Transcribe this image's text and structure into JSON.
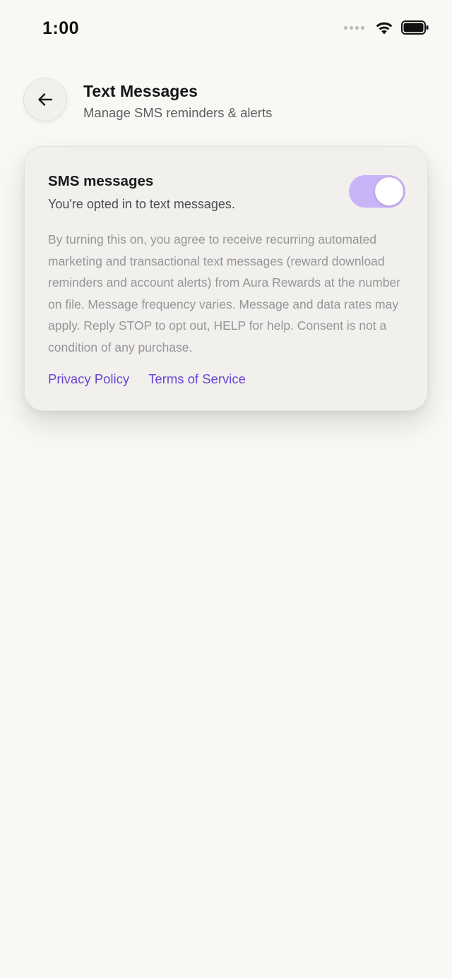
{
  "status_bar": {
    "time": "1:00"
  },
  "header": {
    "back_icon": "arrow-left-icon",
    "title": "Text Messages",
    "subtitle": "Manage SMS reminders & alerts"
  },
  "sms_card": {
    "title": "SMS messages",
    "status_text": "You're opted in to text messages.",
    "toggle_on": true,
    "disclaimer": "By turning this on, you agree to receive recurring automated marketing and transactional text messages (reward download reminders and account alerts) from Aura Rewards at the number on file. Message frequency varies. Message and data rates may apply. Reply STOP to opt out, HELP for help. Consent is not a condition of any purchase.",
    "links": {
      "privacy_policy": "Privacy Policy",
      "terms_of_service": "Terms of Service"
    }
  },
  "colors": {
    "background": "#f9f8f4",
    "card": "#f2f0ec",
    "toggle_on": "#c8b4f7",
    "link": "#6a44d8"
  }
}
